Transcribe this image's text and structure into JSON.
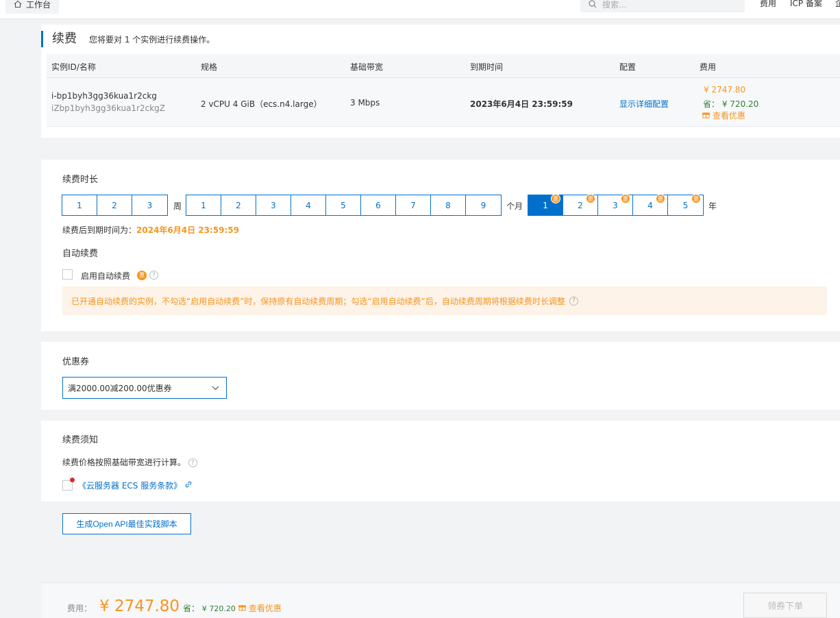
{
  "topbar": {
    "workbench_label": "工作台",
    "search_placeholder": "搜索...",
    "nav": [
      "费用",
      "ICP 备案",
      "企"
    ]
  },
  "header": {
    "title": "续费",
    "subtitle": "您将要对 1 个实例进行续费操作。"
  },
  "instance_table": {
    "columns": [
      "实例ID/名称",
      "规格",
      "基础带宽",
      "到期时间",
      "配置",
      "费用"
    ],
    "row": {
      "id": "i-bp1byh3gg36kua1r2ckg",
      "name": "iZbp1byh3gg36kua1r2ckgZ",
      "spec": "2 vCPU 4 GiB（ecs.n4.large）",
      "bandwidth": "3 Mbps",
      "expire": "2023年6月4日 23:59:59",
      "config_link": "显示详细配置",
      "price": "¥ 2747.80",
      "save_label": "省：",
      "save_value": "¥ 720.20",
      "discount_link": "查看优惠"
    }
  },
  "duration": {
    "label": "续费时长",
    "weeks": [
      "1",
      "2",
      "3"
    ],
    "week_unit": "周",
    "months": [
      "1",
      "2",
      "3",
      "4",
      "5",
      "6",
      "7",
      "8",
      "9"
    ],
    "month_unit": "个月",
    "years": [
      "1",
      "2",
      "3",
      "4",
      "5"
    ],
    "year_unit": "年",
    "selected_year": "1",
    "discount_badge": "惠",
    "after_label": "续费后到期时间为：",
    "after_value": "2024年6月4日 23:59:59"
  },
  "auto_renew": {
    "label": "自动续费",
    "checkbox_label": "启用自动续费",
    "checked": false,
    "notice": "已开通自动续费的实例，不勾选“启用自动续费”时，保持原有自动续费周期；勾选“启用自动续费”后，自动续费周期将根据续费时长调整"
  },
  "coupon": {
    "label": "优惠券",
    "selected": "满2000.00减200.00优惠券"
  },
  "terms": {
    "label": "续费须知",
    "note": "续费价格按照基础带宽进行计算。",
    "agreement": "《云服务器 ECS 服务条款》"
  },
  "api_button": "生成Open API最佳实践脚本",
  "footer": {
    "fee_label": "费用：",
    "price": "¥ 2747.80",
    "save_label": "省：",
    "save_value": "¥ 720.20",
    "discount_link": "查看优惠",
    "order_button": "领券下单"
  },
  "colors": {
    "accent": "#0070cc",
    "price": "#f7941d",
    "save": "#2e7d32"
  }
}
